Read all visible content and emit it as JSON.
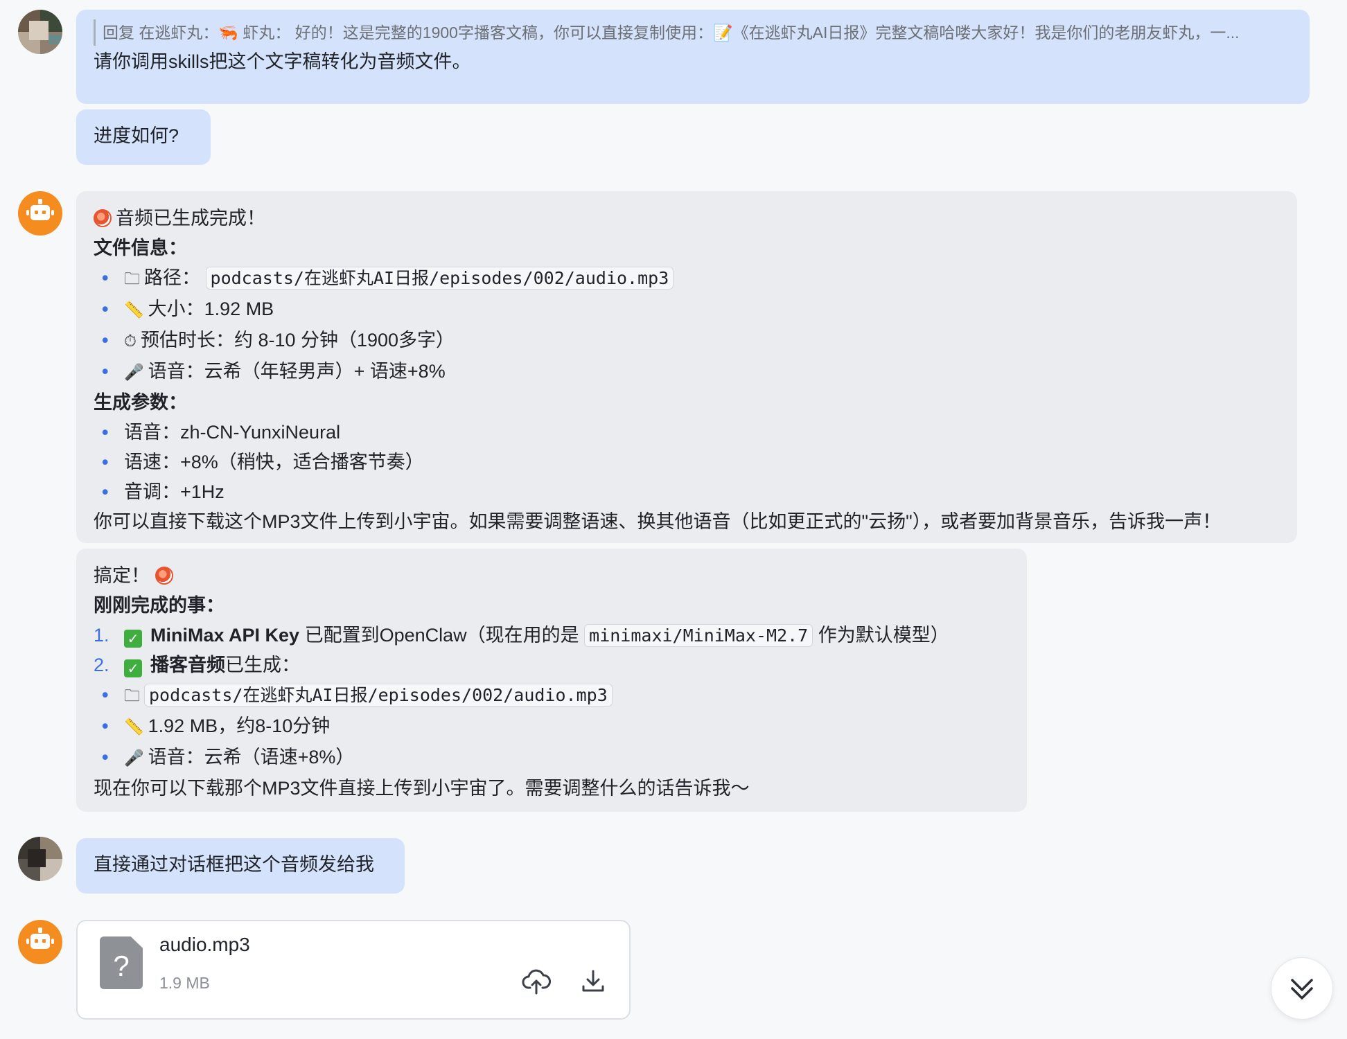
{
  "messages": {
    "m1": {
      "quote": "回复 在逃虾丸：🦐 虾丸： 好的！这是完整的1900字播客文稿，你可以直接复制使用：📝《在逃虾丸AI日报》完整文稿哈喽大家好！我是你们的老朋友虾丸，一...",
      "text": "请你调用skills把这个文字稿转化为音频文件。"
    },
    "m2": {
      "text": "进度如何?"
    },
    "m3": {
      "title": "音频已生成完成！",
      "file_info_heading": "文件信息：",
      "path_label": "路径：",
      "path_value": "podcasts/在逃虾丸AI日报/episodes/002/audio.mp3",
      "size_label": "大小：",
      "size_value": "1.92 MB",
      "duration_label": "预估时长：",
      "duration_value": "约 8-10 分钟（1900多字）",
      "voice_label": "语音：",
      "voice_value": "云希（年轻男声）+ 语速+8%",
      "params_heading": "生成参数：",
      "p_voice": "语音：zh-CN-YunxiNeural",
      "p_rate": "语速：+8%（稍快，适合播客节奏）",
      "p_pitch": "音调：+1Hz",
      "closing": "你可以直接下载这个MP3文件上传到小宇宙。如果需要调整语速、换其他语音（比如更正式的\"云扬\"），或者要加背景音乐，告诉我一声！"
    },
    "m4": {
      "title": "搞定！",
      "done_heading": "刚刚完成的事：",
      "item1_bold": "MiniMax API Key",
      "item1_text": " 已配置到OpenClaw（现在用的是 ",
      "item1_code": "minimaxi/MiniMax-M2.7",
      "item1_tail": " 作为默认模型）",
      "item2_bold": "播客音频",
      "item2_text": "已生成：",
      "path_value": "podcasts/在逃虾丸AI日报/episodes/002/audio.mp3",
      "size_text": "1.92 MB，约8-10分钟",
      "voice_text": "语音：云希（语速+8%）",
      "closing": "现在你可以下载那个MP3文件直接上传到小宇宙了。需要调整什么的话告诉我～"
    },
    "m5": {
      "text": "直接通过对话框把这个音频发给我"
    },
    "m6": {
      "file_name": "audio.mp3",
      "file_size": "1.9 MB"
    }
  },
  "icons": {
    "folder": "folder-icon",
    "ruler": "ruler-icon",
    "stopwatch": "stopwatch-icon",
    "mic": "microphone-icon",
    "check": "check-icon",
    "upload": "cloud-upload-icon",
    "download": "download-icon",
    "scroll": "double-chevron-down-icon"
  },
  "colors": {
    "user_bubble": "#d5e2fb",
    "bot_bubble": "#ebecef",
    "bullet": "#3b6fe0",
    "bot_avatar": "#f58c1f"
  }
}
